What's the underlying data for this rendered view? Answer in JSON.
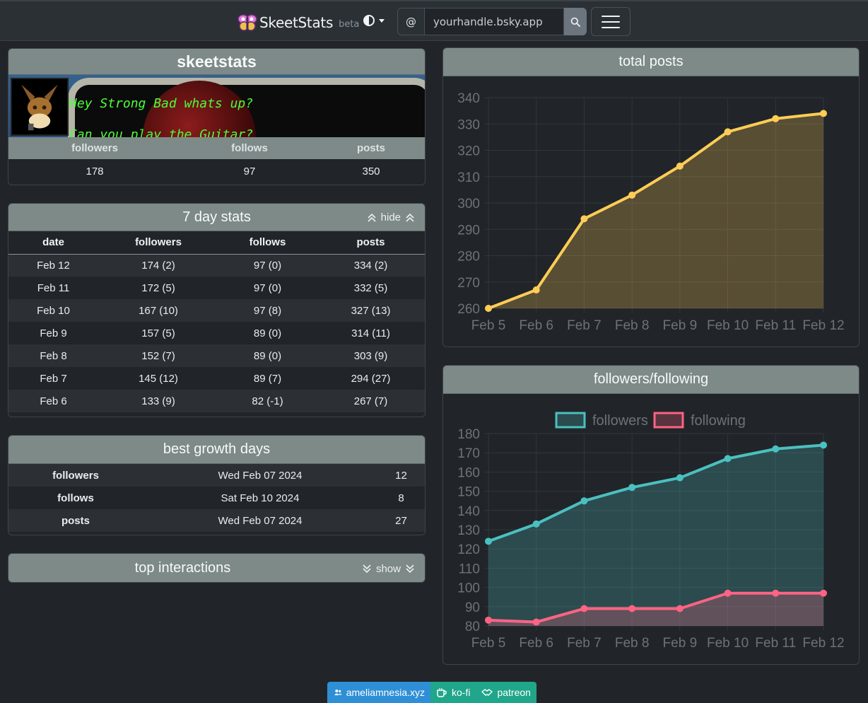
{
  "nav": {
    "brand": "SkeetStats",
    "beta": "beta",
    "at": "@",
    "handle_placeholder": "yourhandle.bsky.app"
  },
  "profile": {
    "name": "skeetstats",
    "banner_line1": "Hey Strong Bad whats up?",
    "banner_line2": "Can you play the Guitar?",
    "labels": {
      "followers": "followers",
      "follows": "follows",
      "posts": "posts"
    },
    "values": {
      "followers": "178",
      "follows": "97",
      "posts": "350"
    }
  },
  "seven_day": {
    "title": "7 day stats",
    "toggle": "hide",
    "columns": [
      "date",
      "followers",
      "follows",
      "posts"
    ],
    "rows": [
      [
        "Feb 12",
        "174 (2)",
        "97 (0)",
        "334 (2)"
      ],
      [
        "Feb 11",
        "172 (5)",
        "97 (0)",
        "332 (5)"
      ],
      [
        "Feb 10",
        "167 (10)",
        "97 (8)",
        "327 (13)"
      ],
      [
        "Feb 9",
        "157 (5)",
        "89 (0)",
        "314 (11)"
      ],
      [
        "Feb 8",
        "152 (7)",
        "89 (0)",
        "303 (9)"
      ],
      [
        "Feb 7",
        "145 (12)",
        "89 (7)",
        "294 (27)"
      ],
      [
        "Feb 6",
        "133 (9)",
        "82 (-1)",
        "267 (7)"
      ]
    ]
  },
  "best_growth": {
    "title": "best growth days",
    "rows": [
      [
        "followers",
        "Wed Feb 07 2024",
        "12"
      ],
      [
        "follows",
        "Sat Feb 10 2024",
        "8"
      ],
      [
        "posts",
        "Wed Feb 07 2024",
        "27"
      ]
    ]
  },
  "top_interactions": {
    "title": "top interactions",
    "toggle": "show"
  },
  "footer": {
    "link1": "ameliamnesia.xyz",
    "link2": "ko-fi",
    "link3": "patreon"
  },
  "colors": {
    "posts_line": "#ffcd56",
    "followers_line": "#4bc0c0",
    "following_line": "#ff6384",
    "header_bg": "#7d8a87"
  },
  "chart_data": [
    {
      "type": "area",
      "title": "total posts",
      "categories": [
        "Feb 5",
        "Feb 6",
        "Feb 7",
        "Feb 8",
        "Feb 9",
        "Feb 10",
        "Feb 11",
        "Feb 12"
      ],
      "series": [
        {
          "values": [
            260,
            267,
            294,
            303,
            314,
            327,
            332,
            334
          ]
        }
      ],
      "ylim": [
        260,
        340
      ],
      "yticks": [
        260,
        270,
        280,
        290,
        300,
        310,
        320,
        330,
        340
      ],
      "grid": true
    },
    {
      "type": "area",
      "title": "followers/following",
      "categories": [
        "Feb 5",
        "Feb 6",
        "Feb 7",
        "Feb 8",
        "Feb 9",
        "Feb 10",
        "Feb 11",
        "Feb 12"
      ],
      "series": [
        {
          "name": "followers",
          "values": [
            124,
            133,
            145,
            152,
            157,
            167,
            172,
            174
          ]
        },
        {
          "name": "following",
          "values": [
            83,
            82,
            89,
            89,
            89,
            97,
            97,
            97
          ]
        }
      ],
      "ylim": [
        80,
        180
      ],
      "yticks": [
        80,
        90,
        100,
        110,
        120,
        130,
        140,
        150,
        160,
        170,
        180
      ],
      "legend": "top",
      "grid": true
    }
  ]
}
